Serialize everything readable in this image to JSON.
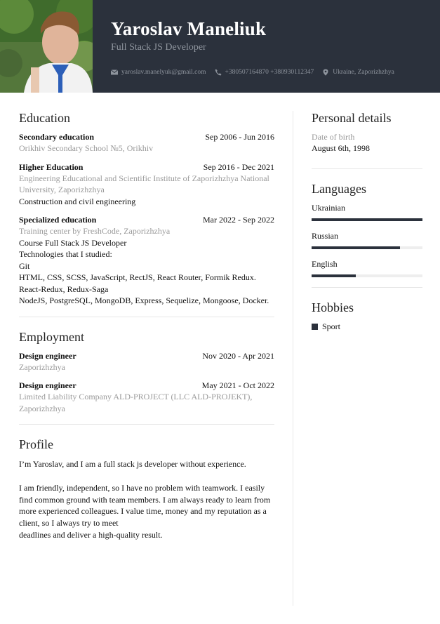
{
  "header": {
    "name": "Yaroslav  Maneliuk",
    "title": "Full Stack JS Developer",
    "email": "yaroslav.manelyuk@gmail.com",
    "phone": "+380507164870 +380930112347",
    "location": "Ukraine, Zaporizhzhya",
    "colors": {
      "background": "#2b313c",
      "name": "#ffffff",
      "muted": "#8e949d"
    }
  },
  "education": {
    "heading": "Education",
    "entries": [
      {
        "title": "Secondary education",
        "date": "Sep 2006 - Jun 2016",
        "institution": "Orikhiv Secondary School №5, Orikhiv"
      },
      {
        "title": "Higher Education",
        "date": "Sep 2016 - Dec 2021",
        "institution": "Engineering Educational and Scientific Institute of Zaporizhzhya National University, Zaporizhzhya",
        "details": [
          "Construction and civil engineering"
        ]
      },
      {
        "title": "Specialized education",
        "date": "Mar 2022 - Sep 2022",
        "institution": "Training center by FreshCode, Zaporizhzhya",
        "details": [
          "Course Full Stack JS Developer",
          "Technologies that I studied:",
          "Git",
          "HTML, CSS, SCSS, JavaScript, RectJS, React Router, Formik Redux. React-Redux, Redux-Saga",
          "NodeJS, PostgreSQL, MongoDB, Express, Sequelize, Mongoose, Docker."
        ]
      }
    ]
  },
  "employment": {
    "heading": "Employment",
    "entries": [
      {
        "title": "Design engineer",
        "date": "Nov 2020 - Apr 2021",
        "institution": "Zaporizhzhya"
      },
      {
        "title": "Design engineer",
        "date": "May 2021 - Oct 2022",
        "institution": "Limited Liability Company ALD-PROJECT (LLC ALD-PROJEKT), Zaporizhzhya"
      }
    ]
  },
  "profile": {
    "heading": "Profile",
    "paragraph1": "I’m Yaroslav,  and I am a full stack js developer without experience.",
    "paragraph2": "I am friendly, independent, so I have no problem with teamwork. I easily find common ground with team members. I am always ready to learn from more experienced colleagues. I value time, money and my reputation as a client, so I always try to meet",
    "paragraph3": "deadlines and deliver a high-quality result."
  },
  "personal": {
    "heading": "Personal details",
    "dob_label": "Date of birth",
    "dob_value": "August 6th, 1998"
  },
  "languages": {
    "heading": "Languages",
    "items": [
      {
        "name": "Ukrainian",
        "level": 1.0
      },
      {
        "name": "Russian",
        "level": 0.8
      },
      {
        "name": "English",
        "level": 0.4
      }
    ]
  },
  "hobbies": {
    "heading": "Hobbies",
    "items": [
      "Sport"
    ]
  }
}
